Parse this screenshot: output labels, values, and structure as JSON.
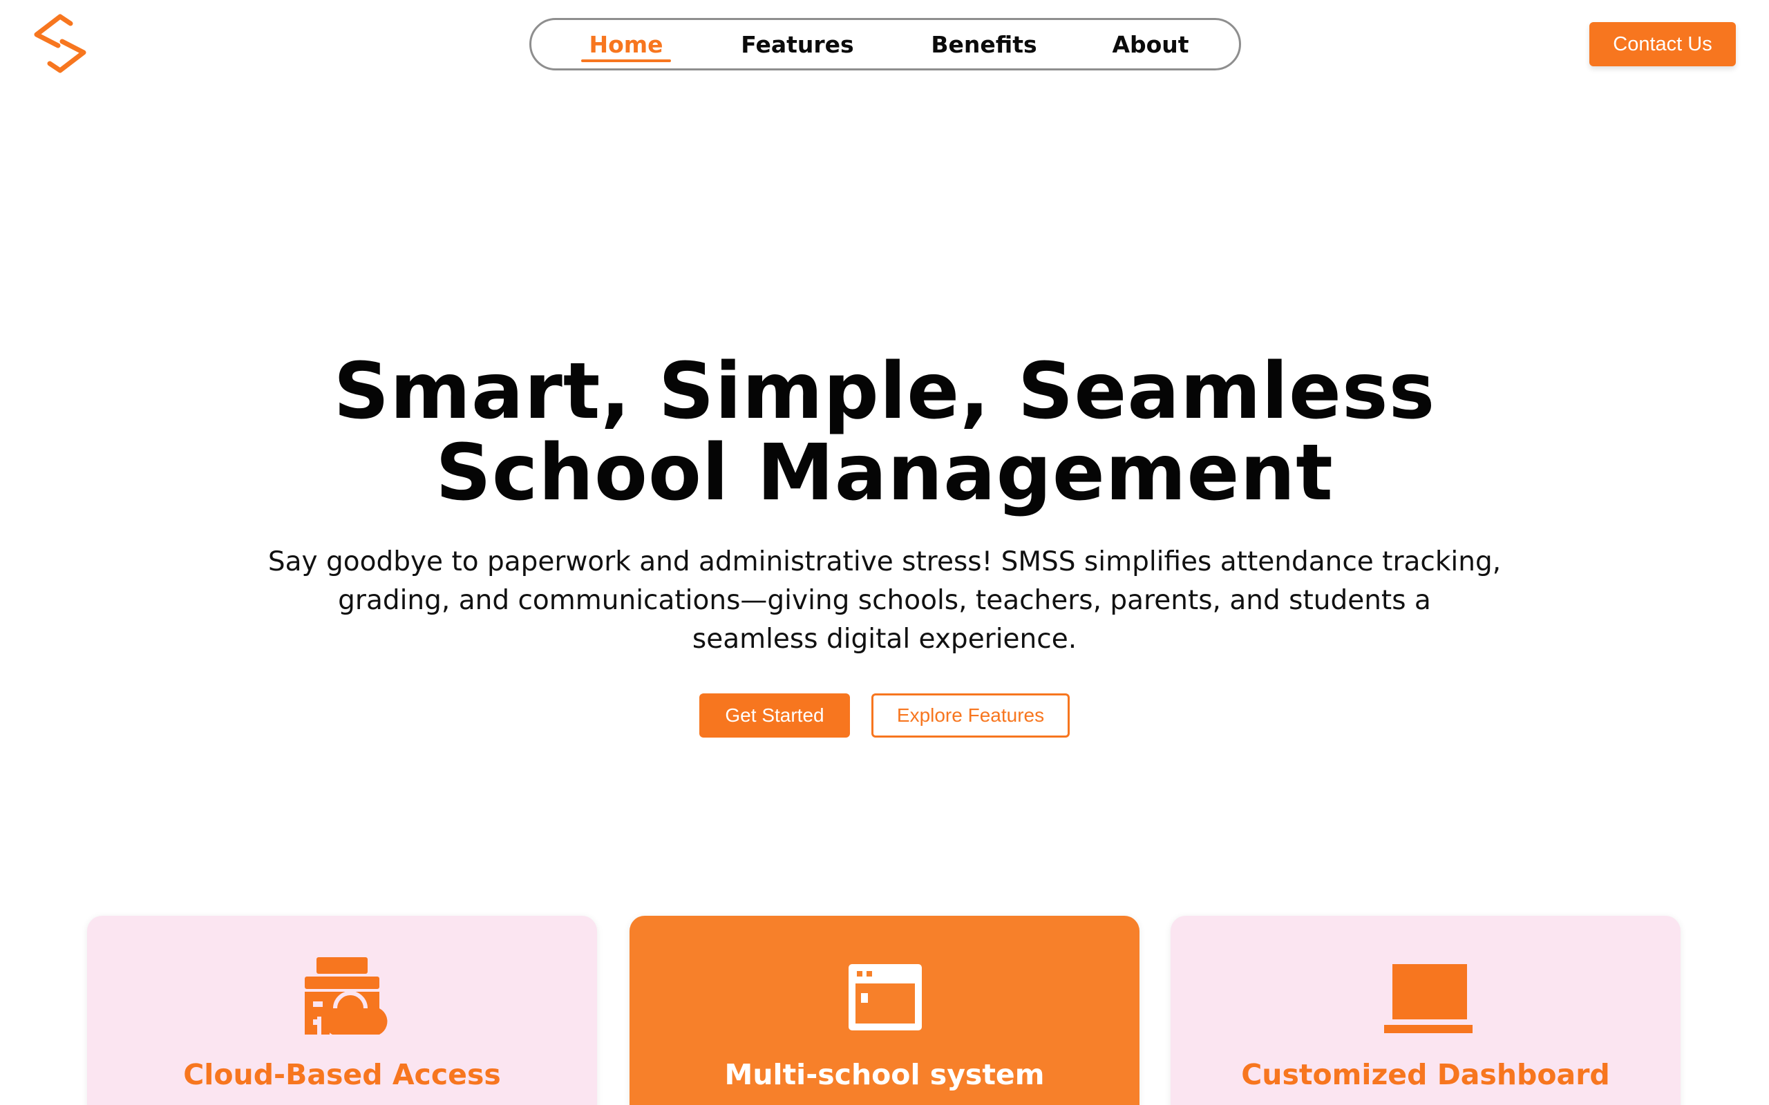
{
  "brand": {
    "logo_icon": "brand-s-logo-icon",
    "accent_color": "#f7761f"
  },
  "nav": {
    "items": [
      {
        "label": "Home",
        "active": true
      },
      {
        "label": "Features",
        "active": false
      },
      {
        "label": "Benefits",
        "active": false
      },
      {
        "label": "About",
        "active": false
      }
    ]
  },
  "header": {
    "contact_label": "Contact Us"
  },
  "hero": {
    "title_line1": "Smart, Simple, Seamless",
    "title_line2": "School Management",
    "subtitle_line1": "Say goodbye to paperwork and administrative stress! SMSS simplifies attendance tracking,",
    "subtitle_line2": "grading, and communications—giving schools, teachers, parents, and students a",
    "subtitle_line3": "seamless digital experience.",
    "primary_button": "Get Started",
    "secondary_button": "Explore Features"
  },
  "cards": [
    {
      "title": "Cloud-Based Access",
      "icon": "cloud-server-icon",
      "background": "#fbe5f1"
    },
    {
      "title": "Multi-school system",
      "icon": "browser-window-icon",
      "background": "#f7802a"
    },
    {
      "title": "Customized Dashboard",
      "icon": "laptop-icon",
      "background": "#fbe5f1"
    }
  ]
}
